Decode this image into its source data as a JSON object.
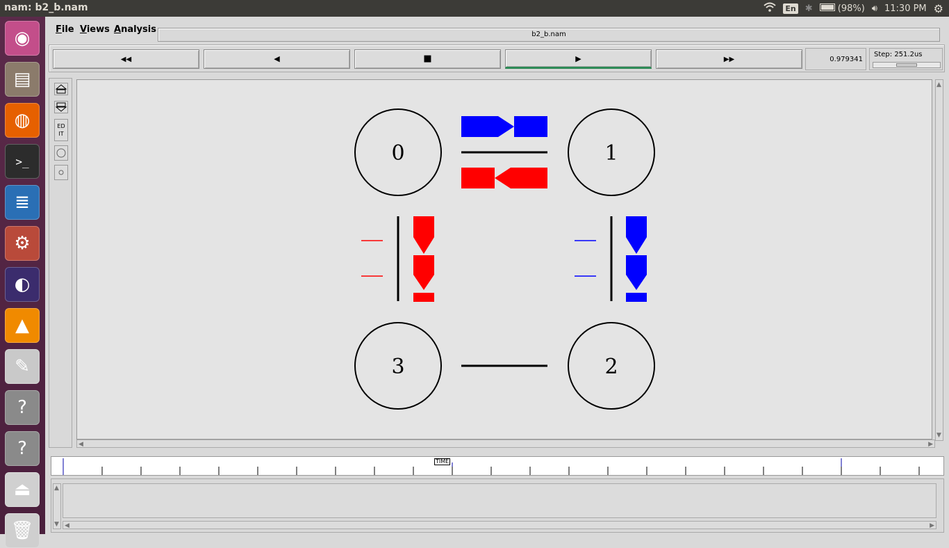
{
  "topbar": {
    "window_title": "nam: b2_b.nam",
    "keyboard_layout": "En",
    "battery": "(98%)",
    "clock": "11:30 PM"
  },
  "launcher": {
    "items": [
      {
        "name": "ubuntu-dash",
        "icon": "ubuntu-logo-icon",
        "color": "#c34e8a"
      },
      {
        "name": "files",
        "icon": "file-cabinet-icon",
        "color": "#8b7b6b"
      },
      {
        "name": "firefox",
        "icon": "firefox-icon",
        "color": "#e66000"
      },
      {
        "name": "terminal",
        "icon": "terminal-icon",
        "color": "#2c2c2c"
      },
      {
        "name": "libreoffice-writer",
        "icon": "document-icon",
        "color": "#2a6fb5"
      },
      {
        "name": "system-settings",
        "icon": "settings-wrench-icon",
        "color": "#b94a3a"
      },
      {
        "name": "eclipse",
        "icon": "eclipse-icon",
        "color": "#3b2c6d"
      },
      {
        "name": "vlc",
        "icon": "traffic-cone-icon",
        "color": "#f08a00"
      },
      {
        "name": "text-editor",
        "icon": "text-editor-icon",
        "color": "#c9c9c9"
      },
      {
        "name": "unknown-1",
        "icon": "question-mark-icon",
        "color": "#8a8a8a"
      },
      {
        "name": "unknown-2",
        "icon": "question-mark-icon",
        "color": "#8a8a8a"
      },
      {
        "name": "usb-drive",
        "icon": "usb-drive-icon",
        "color": "#d0d0d0"
      },
      {
        "name": "trash",
        "icon": "trash-icon",
        "color": "#cfcfcf"
      }
    ]
  },
  "menubar": {
    "file": "File",
    "views": "Views",
    "analysis": "Analysis",
    "file_name": "b2_b.nam"
  },
  "controls": {
    "rewind": "◀◀",
    "back": "◀",
    "stop": "■",
    "play": "▶",
    "fast_forward": "▶▶",
    "current_time": "0.979341",
    "step": "Step: 251.2us",
    "step_position": 0.5
  },
  "toolbar": {
    "edit": "ED IT"
  },
  "timeline": {
    "marker_label": "TIME"
  },
  "topology": {
    "nodes": [
      {
        "id": "0",
        "label": "0"
      },
      {
        "id": "1",
        "label": "1"
      },
      {
        "id": "2",
        "label": "2"
      },
      {
        "id": "3",
        "label": "3"
      }
    ],
    "links": [
      [
        "0",
        "1"
      ],
      [
        "1",
        "2"
      ],
      [
        "2",
        "3"
      ],
      [
        "3",
        "0"
      ]
    ],
    "colors": {
      "flow_a": "#0000ff",
      "flow_b": "#ff0000"
    }
  }
}
